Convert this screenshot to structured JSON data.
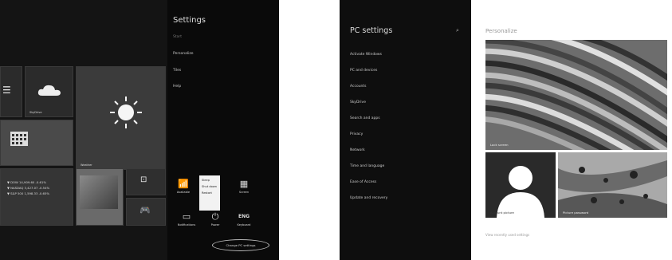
{
  "start_screen": {
    "tiles": [
      {
        "name": "people-tile",
        "label": ""
      },
      {
        "name": "skydrive-tile",
        "label": "SkyDrive"
      },
      {
        "name": "weather-tile",
        "label": "Weather"
      },
      {
        "name": "calendar-tile",
        "label": ""
      },
      {
        "name": "finance-tile",
        "label": ""
      },
      {
        "name": "photos-tile",
        "label": ""
      },
      {
        "name": "video-tile",
        "label": ""
      },
      {
        "name": "games-tile",
        "label": ""
      }
    ],
    "finance_lines": [
      "▼ DOW 14,909.60 -0.61%",
      "▼ NASDAQ 3,427.07 -0.54%",
      "▼ S&P 500 1,598.33 -0.65%"
    ]
  },
  "settings_charm": {
    "title": "Settings",
    "subtitle": "Start",
    "items": [
      "Personalize",
      "Tiles",
      "Help"
    ],
    "icons": [
      {
        "name": "available-icon",
        "glyph": "📶",
        "label": "Available"
      },
      {
        "name": "screen-icon",
        "glyph": "▦",
        "label": "Screen"
      },
      {
        "name": "notifications-icon",
        "glyph": "▭",
        "label": "Notifications"
      },
      {
        "name": "power-icon",
        "glyph": "⏻",
        "label": "Power"
      },
      {
        "name": "keyboard-icon",
        "glyph": "ENG",
        "label": "Keyboard"
      }
    ],
    "power_menu": [
      "Sleep",
      "Shut down",
      "Restart"
    ],
    "change_pc_settings": "Change PC settings"
  },
  "pc_settings": {
    "title": "PC settings",
    "nav_items": [
      "Activate Windows",
      "PC and devices",
      "Accounts",
      "SkyDrive",
      "Search and apps",
      "Privacy",
      "Network",
      "Time and language",
      "Ease of Access",
      "Update and recovery"
    ],
    "page_title": "Personalize",
    "lock_screen_caption": "Lock screen",
    "account_picture_caption": "Account picture",
    "start_background_caption": "Picture password",
    "bottom_link": "View recently used settings"
  }
}
